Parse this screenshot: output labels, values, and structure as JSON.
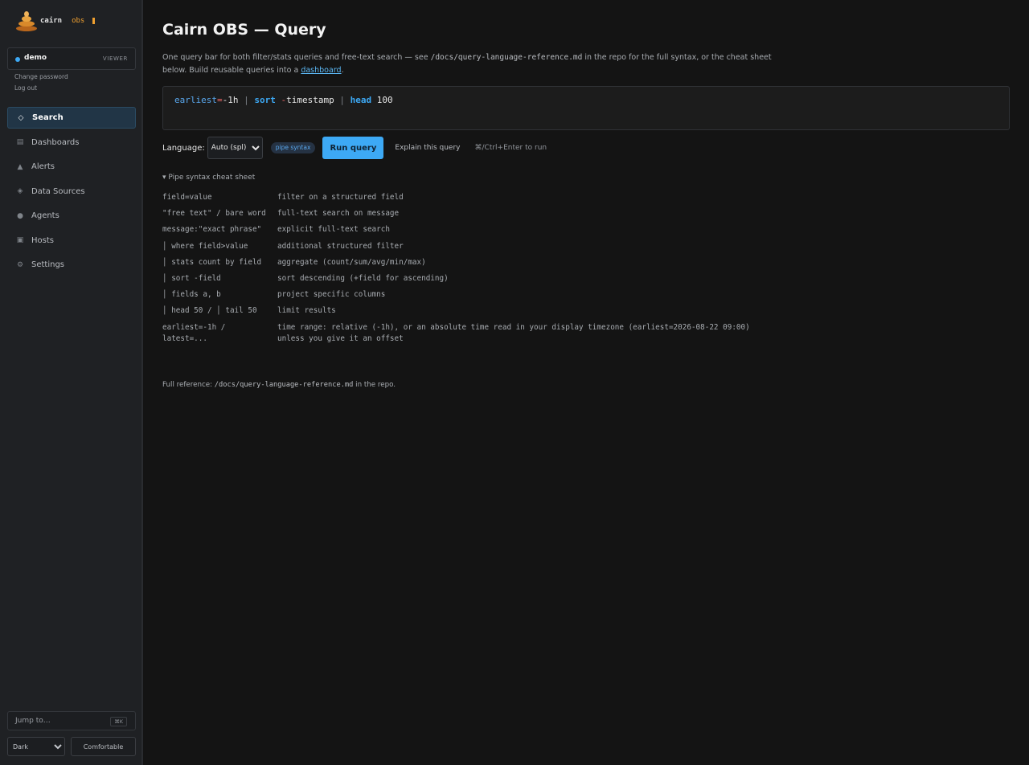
{
  "brand": {
    "name": "cairn",
    "sub": "obs"
  },
  "user": {
    "name": "demo",
    "role": "VIEWER",
    "change_password": "Change password",
    "logout": "Log out"
  },
  "sidebar": {
    "items": [
      {
        "label": "Search",
        "icon": "diamond-icon",
        "glyph": "◇",
        "active": true
      },
      {
        "label": "Dashboards",
        "icon": "dashboard-icon",
        "glyph": "▤"
      },
      {
        "label": "Alerts",
        "icon": "alert-icon",
        "glyph": "▲"
      },
      {
        "label": "Data Sources",
        "icon": "data-source-icon",
        "glyph": "◈"
      },
      {
        "label": "Agents",
        "icon": "agent-icon",
        "glyph": "●"
      },
      {
        "label": "Hosts",
        "icon": "host-icon",
        "glyph": "▣"
      },
      {
        "label": "Settings",
        "icon": "gear-icon",
        "glyph": "⚙"
      }
    ],
    "jump_label": "Jump to…",
    "jump_shortcut": "⌘K",
    "theme_options": [
      "Dark"
    ],
    "theme_value": "Dark",
    "density_label": "Comfortable"
  },
  "main": {
    "title": "Cairn OBS — Query",
    "intro": {
      "p1": "One query bar for both filter/stats queries and free-text search — see ",
      "code": "/docs/query-language-reference.md",
      "p2": " in the repo for the full syntax, or the cheat sheet below. Build reusable queries into a ",
      "link": "dashboard",
      "p3": "."
    },
    "query": {
      "field1": "earliest",
      "eq": "=",
      "val1": "-1h",
      "pipe1": "|",
      "kw1": "sort",
      "minus": "-",
      "field2": "timestamp",
      "pipe2": "|",
      "kw2": "head",
      "val2": "100"
    },
    "language_label": "Language:",
    "language_options": [
      "Auto (spl)"
    ],
    "language_value": "Auto (spl)",
    "syntax_badge": "pipe syntax",
    "run_label": "Run query",
    "explain_label": "Explain this query",
    "run_hint": "⌘/Ctrl+Enter to run",
    "cheat_title": "Pipe syntax cheat sheet",
    "cheat_rows": [
      {
        "syntax": "field=value",
        "desc": "filter on a structured field"
      },
      {
        "syntax": "\"free text\" / bare word",
        "desc": "full-text search on message"
      },
      {
        "syntax": "message:\"exact phrase\"",
        "desc": "explicit full-text search"
      },
      {
        "syntax": "│ where field>value",
        "desc": "additional structured filter"
      },
      {
        "syntax": "│ stats count by field",
        "desc": "aggregate (count/sum/avg/min/max)"
      },
      {
        "syntax": "│ sort -field",
        "desc": "sort descending (+field for ascending)"
      },
      {
        "syntax": "│ fields a, b",
        "desc": "project specific columns"
      },
      {
        "syntax": "│ head 50 / │ tail 50",
        "desc": "limit results"
      },
      {
        "syntax": "earliest=-1h / latest=...",
        "desc": "time range: relative (-1h), or an absolute time read in your display timezone (earliest=2026-08-22 09:00) unless you give it an offset"
      }
    ],
    "footer": {
      "p1": "Full reference: ",
      "code": "/docs/query-language-reference.md",
      "p2": " in the repo."
    }
  },
  "colors": {
    "accent": "#3da9f5",
    "brand": "#f0a030",
    "background": "#141414",
    "sidebar": "#1f2124"
  }
}
